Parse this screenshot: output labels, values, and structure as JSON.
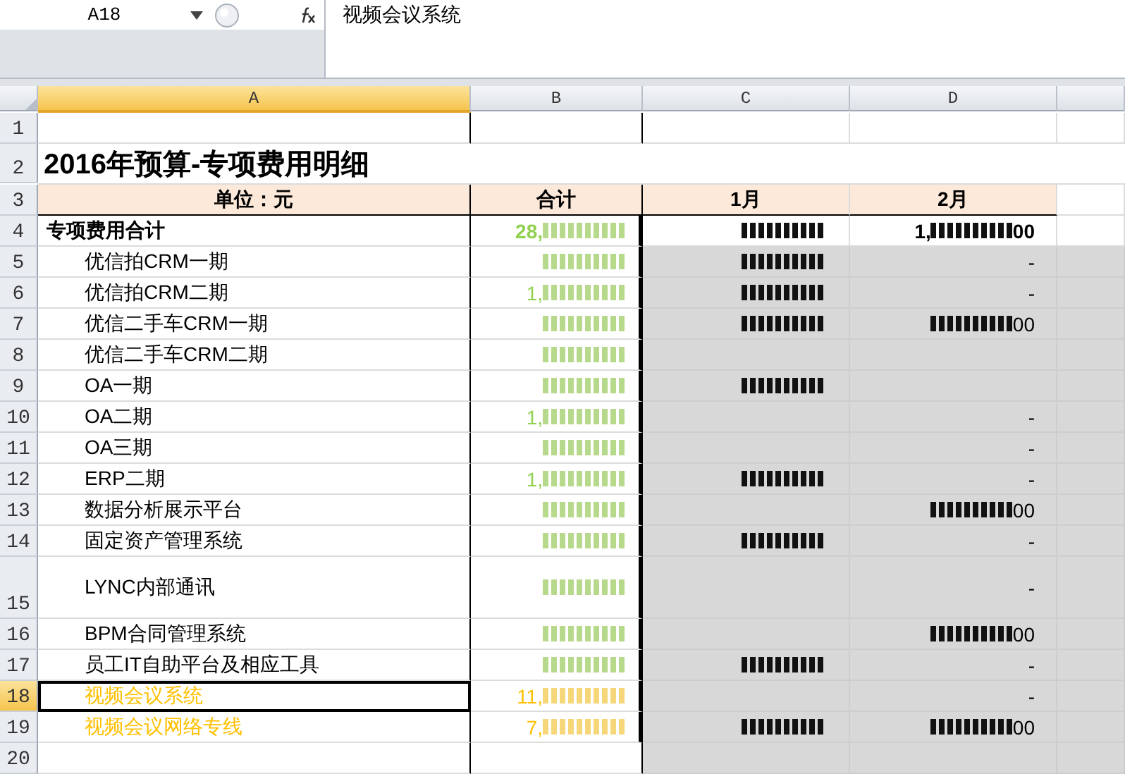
{
  "name_box": "A18",
  "formula": "视频会议系统",
  "columns": [
    {
      "label": "A",
      "selected": true
    },
    {
      "label": "B",
      "selected": false
    },
    {
      "label": "C",
      "selected": false
    },
    {
      "label": "D",
      "selected": false
    }
  ],
  "rows": [
    {
      "num": "1",
      "kind": "blank",
      "selected": false
    },
    {
      "num": "2",
      "kind": "title",
      "selected": false,
      "title": "2016年预算-专项费用明细"
    },
    {
      "num": "3",
      "kind": "header",
      "selected": false,
      "cells": [
        "单位：元",
        "合计",
        "1月",
        "2月"
      ]
    },
    {
      "num": "4",
      "kind": "total",
      "selected": false,
      "flagged": false,
      "label": "专项费用合计",
      "total": {
        "shown": "28,",
        "obscured": true
      },
      "m1": {
        "obscured": true
      },
      "m2": {
        "shown": "1,",
        "obscured": true,
        "shown_after": "00"
      }
    },
    {
      "num": "5",
      "kind": "item",
      "selected": false,
      "flagged": false,
      "label": "优信拍CRM一期",
      "total": {
        "obscured": true
      },
      "m1": {
        "obscured": true
      },
      "m2": {
        "shown": "-"
      }
    },
    {
      "num": "6",
      "kind": "item",
      "selected": false,
      "flagged": false,
      "label": "优信拍CRM二期",
      "total": {
        "shown": "1,",
        "obscured": true
      },
      "m1": {
        "obscured": true
      },
      "m2": {
        "shown": "-"
      }
    },
    {
      "num": "7",
      "kind": "item",
      "selected": false,
      "flagged": false,
      "label": "优信二手车CRM一期",
      "total": {
        "obscured": true
      },
      "m1": {
        "obscured": true
      },
      "m2": {
        "obscured": true,
        "shown_after": "00"
      }
    },
    {
      "num": "8",
      "kind": "item",
      "selected": false,
      "flagged": false,
      "label": "优信二手车CRM二期",
      "total": {
        "obscured": true
      }
    },
    {
      "num": "9",
      "kind": "item",
      "selected": false,
      "flagged": false,
      "label": "OA一期",
      "total": {
        "obscured": true
      },
      "m1": {
        "obscured": true
      }
    },
    {
      "num": "10",
      "kind": "item",
      "selected": false,
      "flagged": false,
      "label": "OA二期",
      "total": {
        "shown": "1,",
        "obscured": true
      },
      "m2": {
        "shown": "-"
      }
    },
    {
      "num": "11",
      "kind": "item",
      "selected": false,
      "flagged": false,
      "label": "OA三期",
      "total": {
        "obscured": true
      },
      "m2": {
        "shown": "-"
      }
    },
    {
      "num": "12",
      "kind": "item",
      "selected": false,
      "flagged": false,
      "label": "ERP二期",
      "total": {
        "shown": "1,",
        "obscured": true
      },
      "m1": {
        "obscured": true
      },
      "m2": {
        "shown": "-"
      }
    },
    {
      "num": "13",
      "kind": "item",
      "selected": false,
      "flagged": false,
      "label": "数据分析展示平台",
      "total": {
        "obscured": true
      },
      "m2": {
        "obscured": true,
        "shown_after": "00"
      }
    },
    {
      "num": "14",
      "kind": "item",
      "selected": false,
      "flagged": false,
      "label": "固定资产管理系统",
      "total": {
        "obscured": true
      },
      "m1": {
        "obscured": true
      },
      "m2": {
        "shown": "-"
      }
    },
    {
      "num": "15",
      "kind": "tall",
      "selected": false,
      "flagged": false,
      "label": "LYNC内部通讯",
      "total": {
        "obscured": true
      },
      "m2": {
        "shown": "-"
      }
    },
    {
      "num": "16",
      "kind": "item",
      "selected": false,
      "flagged": false,
      "label": "BPM合同管理系统",
      "total": {
        "obscured": true
      },
      "m2": {
        "obscured": true,
        "shown_after": "00"
      }
    },
    {
      "num": "17",
      "kind": "item",
      "selected": false,
      "flagged": false,
      "label": "员工IT自助平台及相应工具",
      "total": {
        "obscured": true
      },
      "m1": {
        "obscured": true
      },
      "m2": {
        "shown": "-"
      }
    },
    {
      "num": "18",
      "kind": "item",
      "selected": true,
      "flagged": true,
      "label": "视频会议系统",
      "total": {
        "shown": "11,",
        "obscured": true
      },
      "m2": {
        "shown": "-"
      }
    },
    {
      "num": "19",
      "kind": "item",
      "selected": false,
      "flagged": true,
      "label": "视频会议网络专线",
      "total": {
        "shown": "7,",
        "obscured": true
      },
      "m1": {
        "obscured": true
      },
      "m2": {
        "obscured": true,
        "shown_after": "00"
      }
    },
    {
      "num": "20",
      "kind": "blank",
      "selected": false
    }
  ]
}
